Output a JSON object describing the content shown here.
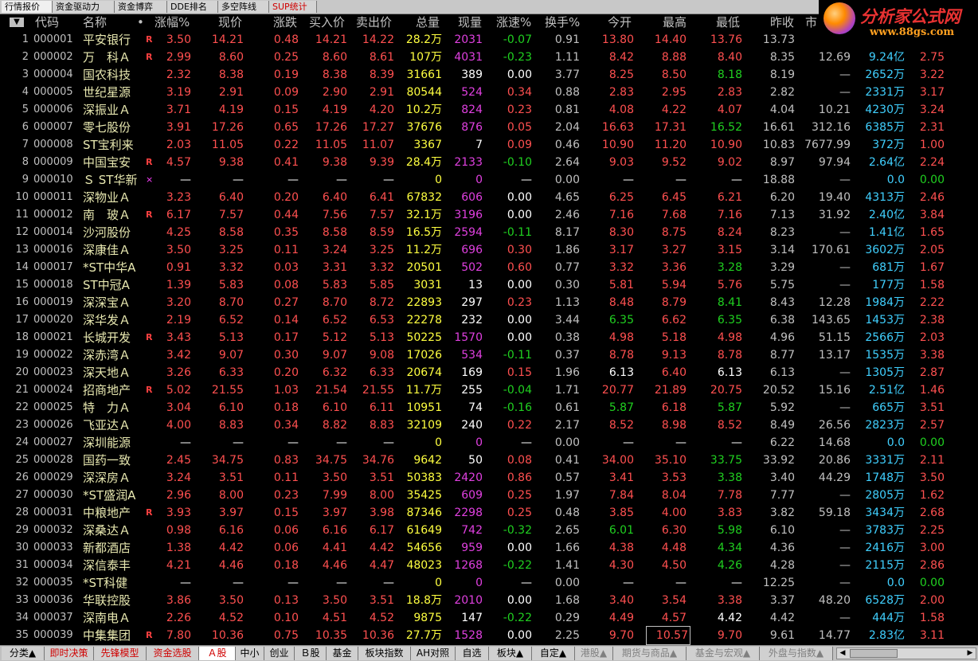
{
  "tabs": [
    "行情报价",
    "资金驱动力",
    "资金博弈",
    "DDE排名",
    "多空阵线",
    "SUP统计"
  ],
  "logo": {
    "title": "分析家公式网",
    "url": "www.88gs.com"
  },
  "header": {
    "sort_arrow": "▼",
    "code": "代码",
    "name": "名称",
    "dot": "•",
    "pct": "涨幅%",
    "price": "现价",
    "chg": "涨跌",
    "bid": "买入价",
    "ask": "卖出价",
    "vol": "总量",
    "cur": "现量",
    "speed": "涨速%",
    "turnover": "换手%",
    "open": "今开",
    "high": "最高",
    "low": "最低",
    "prev": "昨收",
    "pe": "市"
  },
  "colors": {
    "up": "#ff5050",
    "down": "#20d020",
    "flat": "#ffffff",
    "volume": "#ffff40",
    "current_vol": "#e040e0",
    "amount": "#40d0ff"
  },
  "rows": [
    [
      "1",
      "000001",
      "平安银行",
      "R",
      "3.50",
      "14.21",
      "0.48",
      "14.21",
      "14.22",
      "28.2万",
      "2031",
      "-0.07",
      "0.91",
      "13.80",
      "14.40",
      "13.76",
      "13.73",
      "",
      "",
      ""
    ],
    [
      "2",
      "000002",
      "万　科Ａ",
      "R",
      "2.99",
      "8.60",
      "0.25",
      "8.60",
      "8.61",
      "107万",
      "4031",
      "-0.23",
      "1.11",
      "8.42",
      "8.88",
      "8.40",
      "8.35",
      "12.69",
      "9.24亿",
      "2.75"
    ],
    [
      "3",
      "000004",
      "国农科技",
      "",
      "2.32",
      "8.38",
      "0.19",
      "8.38",
      "8.39",
      "31661",
      "389",
      "0.00",
      "3.77",
      "8.25",
      "8.50",
      "8.18",
      "8.19",
      "—",
      "2652万",
      "3.22"
    ],
    [
      "4",
      "000005",
      "世纪星源",
      "",
      "3.19",
      "2.91",
      "0.09",
      "2.90",
      "2.91",
      "80544",
      "524",
      "0.34",
      "0.88",
      "2.83",
      "2.95",
      "2.83",
      "2.82",
      "—",
      "2331万",
      "3.17"
    ],
    [
      "5",
      "000006",
      "深振业Ａ",
      "",
      "3.71",
      "4.19",
      "0.15",
      "4.19",
      "4.20",
      "10.2万",
      "824",
      "0.23",
      "0.81",
      "4.08",
      "4.22",
      "4.07",
      "4.04",
      "10.21",
      "4230万",
      "3.24"
    ],
    [
      "6",
      "000007",
      "零七股份",
      "",
      "3.91",
      "17.26",
      "0.65",
      "17.26",
      "17.27",
      "37676",
      "876",
      "0.05",
      "2.04",
      "16.63",
      "17.31",
      "16.52",
      "16.61",
      "312.16",
      "6385万",
      "2.31"
    ],
    [
      "7",
      "000008",
      "ST宝利来",
      "",
      "2.03",
      "11.05",
      "0.22",
      "11.05",
      "11.07",
      "3367",
      "7",
      "0.09",
      "0.46",
      "10.90",
      "11.20",
      "10.90",
      "10.83",
      "7677.99",
      "372万",
      "1.00"
    ],
    [
      "8",
      "000009",
      "中国宝安",
      "R",
      "4.57",
      "9.38",
      "0.41",
      "9.38",
      "9.39",
      "28.4万",
      "2133",
      "-0.10",
      "2.64",
      "9.03",
      "9.52",
      "9.02",
      "8.97",
      "97.94",
      "2.64亿",
      "2.24"
    ],
    [
      "9",
      "000010",
      "Ｓ ST华新",
      "×",
      "—",
      "—",
      "—",
      "—",
      "—",
      "0",
      "0",
      "—",
      "0.00",
      "—",
      "—",
      "—",
      "18.88",
      "—",
      "0.0",
      "0.00"
    ],
    [
      "10",
      "000011",
      "深物业Ａ",
      "",
      "3.23",
      "6.40",
      "0.20",
      "6.40",
      "6.41",
      "67832",
      "606",
      "0.00",
      "4.65",
      "6.25",
      "6.45",
      "6.21",
      "6.20",
      "19.40",
      "4313万",
      "2.46"
    ],
    [
      "11",
      "000012",
      "南　玻Ａ",
      "R",
      "6.17",
      "7.57",
      "0.44",
      "7.56",
      "7.57",
      "32.1万",
      "3196",
      "0.00",
      "2.46",
      "7.16",
      "7.68",
      "7.16",
      "7.13",
      "31.92",
      "2.40亿",
      "3.84"
    ],
    [
      "12",
      "000014",
      "沙河股份",
      "",
      "4.25",
      "8.58",
      "0.35",
      "8.58",
      "8.59",
      "16.5万",
      "2594",
      "-0.11",
      "8.17",
      "8.30",
      "8.75",
      "8.24",
      "8.23",
      "—",
      "1.41亿",
      "1.65"
    ],
    [
      "13",
      "000016",
      "深康佳Ａ",
      "",
      "3.50",
      "3.25",
      "0.11",
      "3.24",
      "3.25",
      "11.2万",
      "696",
      "0.30",
      "1.86",
      "3.17",
      "3.27",
      "3.15",
      "3.14",
      "170.61",
      "3602万",
      "2.05"
    ],
    [
      "14",
      "000017",
      "*ST中华A",
      "",
      "0.91",
      "3.32",
      "0.03",
      "3.31",
      "3.32",
      "20501",
      "502",
      "0.60",
      "0.77",
      "3.32",
      "3.36",
      "3.28",
      "3.29",
      "—",
      "681万",
      "1.67"
    ],
    [
      "15",
      "000018",
      "ST中冠A",
      "",
      "1.39",
      "5.83",
      "0.08",
      "5.83",
      "5.85",
      "3031",
      "13",
      "0.00",
      "0.30",
      "5.81",
      "5.94",
      "5.76",
      "5.75",
      "—",
      "177万",
      "1.58"
    ],
    [
      "16",
      "000019",
      "深深宝Ａ",
      "",
      "3.20",
      "8.70",
      "0.27",
      "8.70",
      "8.72",
      "22893",
      "297",
      "0.23",
      "1.13",
      "8.48",
      "8.79",
      "8.41",
      "8.43",
      "12.28",
      "1984万",
      "2.22"
    ],
    [
      "17",
      "000020",
      "深华发Ａ",
      "",
      "2.19",
      "6.52",
      "0.14",
      "6.52",
      "6.53",
      "22278",
      "232",
      "0.00",
      "3.44",
      "6.35",
      "6.62",
      "6.35",
      "6.38",
      "143.65",
      "1453万",
      "2.38"
    ],
    [
      "18",
      "000021",
      "长城开发",
      "R",
      "3.43",
      "5.13",
      "0.17",
      "5.12",
      "5.13",
      "50225",
      "1570",
      "0.00",
      "0.38",
      "4.98",
      "5.18",
      "4.98",
      "4.96",
      "51.15",
      "2566万",
      "2.03"
    ],
    [
      "19",
      "000022",
      "深赤湾Ａ",
      "",
      "3.42",
      "9.07",
      "0.30",
      "9.07",
      "9.08",
      "17026",
      "534",
      "-0.11",
      "0.37",
      "8.78",
      "9.13",
      "8.78",
      "8.77",
      "13.17",
      "1535万",
      "3.38"
    ],
    [
      "20",
      "000023",
      "深天地Ａ",
      "",
      "3.26",
      "6.33",
      "0.20",
      "6.32",
      "6.33",
      "20674",
      "169",
      "0.15",
      "1.96",
      "6.13",
      "6.40",
      "6.13",
      "6.13",
      "—",
      "1305万",
      "2.87"
    ],
    [
      "21",
      "000024",
      "招商地产",
      "R",
      "5.02",
      "21.55",
      "1.03",
      "21.54",
      "21.55",
      "11.7万",
      "255",
      "-0.04",
      "1.71",
      "20.77",
      "21.89",
      "20.75",
      "20.52",
      "15.16",
      "2.51亿",
      "1.46"
    ],
    [
      "22",
      "000025",
      "特　力Ａ",
      "",
      "3.04",
      "6.10",
      "0.18",
      "6.10",
      "6.11",
      "10951",
      "74",
      "-0.16",
      "0.61",
      "5.87",
      "6.18",
      "5.87",
      "5.92",
      "—",
      "665万",
      "3.51"
    ],
    [
      "23",
      "000026",
      "飞亚达Ａ",
      "",
      "4.00",
      "8.83",
      "0.34",
      "8.82",
      "8.83",
      "32109",
      "240",
      "0.22",
      "2.17",
      "8.52",
      "8.98",
      "8.52",
      "8.49",
      "26.56",
      "2823万",
      "2.57"
    ],
    [
      "24",
      "000027",
      "深圳能源",
      "",
      "—",
      "—",
      "—",
      "—",
      "—",
      "0",
      "0",
      "—",
      "0.00",
      "—",
      "—",
      "—",
      "6.22",
      "14.68",
      "0.0",
      "0.00"
    ],
    [
      "25",
      "000028",
      "国药一致",
      "",
      "2.45",
      "34.75",
      "0.83",
      "34.75",
      "34.76",
      "9642",
      "50",
      "0.08",
      "0.41",
      "34.00",
      "35.10",
      "33.75",
      "33.92",
      "20.86",
      "3331万",
      "2.11"
    ],
    [
      "26",
      "000029",
      "深深房Ａ",
      "",
      "3.24",
      "3.51",
      "0.11",
      "3.50",
      "3.51",
      "50383",
      "2420",
      "0.86",
      "0.57",
      "3.41",
      "3.53",
      "3.38",
      "3.40",
      "44.29",
      "1748万",
      "3.50"
    ],
    [
      "27",
      "000030",
      "*ST盛润A",
      "",
      "2.96",
      "8.00",
      "0.23",
      "7.99",
      "8.00",
      "35425",
      "609",
      "0.25",
      "1.97",
      "7.84",
      "8.04",
      "7.78",
      "7.77",
      "—",
      "2805万",
      "1.62"
    ],
    [
      "28",
      "000031",
      "中粮地产",
      "R",
      "3.93",
      "3.97",
      "0.15",
      "3.97",
      "3.98",
      "87346",
      "2298",
      "0.25",
      "0.48",
      "3.85",
      "4.00",
      "3.83",
      "3.82",
      "59.18",
      "3434万",
      "2.68"
    ],
    [
      "29",
      "000032",
      "深桑达Ａ",
      "",
      "0.98",
      "6.16",
      "0.06",
      "6.16",
      "6.17",
      "61649",
      "742",
      "-0.32",
      "2.65",
      "6.01",
      "6.30",
      "5.98",
      "6.10",
      "—",
      "3783万",
      "2.25"
    ],
    [
      "30",
      "000033",
      "新都酒店",
      "",
      "1.38",
      "4.42",
      "0.06",
      "4.41",
      "4.42",
      "54656",
      "959",
      "0.00",
      "1.66",
      "4.38",
      "4.48",
      "4.34",
      "4.36",
      "—",
      "2416万",
      "3.00"
    ],
    [
      "31",
      "000034",
      "深信泰丰",
      "",
      "4.21",
      "4.46",
      "0.18",
      "4.46",
      "4.47",
      "48023",
      "1268",
      "-0.22",
      "1.41",
      "4.30",
      "4.50",
      "4.26",
      "4.28",
      "—",
      "2115万",
      "2.86"
    ],
    [
      "32",
      "000035",
      "*ST科健",
      "",
      "—",
      "—",
      "—",
      "—",
      "—",
      "0",
      "0",
      "—",
      "0.00",
      "—",
      "—",
      "—",
      "12.25",
      "—",
      "0.0",
      "0.00"
    ],
    [
      "33",
      "000036",
      "华联控股",
      "",
      "3.86",
      "3.50",
      "0.13",
      "3.50",
      "3.51",
      "18.8万",
      "2010",
      "0.00",
      "1.68",
      "3.40",
      "3.54",
      "3.38",
      "3.37",
      "48.20",
      "6528万",
      "2.00"
    ],
    [
      "34",
      "000037",
      "深南电Ａ",
      "",
      "2.26",
      "4.52",
      "0.10",
      "4.51",
      "4.52",
      "9875",
      "147",
      "-0.22",
      "0.29",
      "4.49",
      "4.57",
      "4.42",
      "4.42",
      "—",
      "444万",
      "1.58"
    ],
    [
      "35",
      "000039",
      "中集集团",
      "R",
      "7.80",
      "10.36",
      "0.75",
      "10.35",
      "10.36",
      "27.7万",
      "1528",
      "0.00",
      "2.25",
      "9.70",
      "10.57",
      "9.70",
      "9.61",
      "14.77",
      "2.83亿",
      "3.11"
    ]
  ],
  "bottom_tabs": [
    "分类▲",
    "即时决策",
    "先锋模型",
    "资金选股",
    "Ａ股",
    "中小",
    "创业",
    "Ｂ股",
    "基金",
    "板块指数",
    "AH对照",
    "自选",
    "板块▲",
    "自定▲",
    "港股▲",
    "期货与商品▲",
    "基金与宏观▲",
    "外盘与指数▲"
  ]
}
